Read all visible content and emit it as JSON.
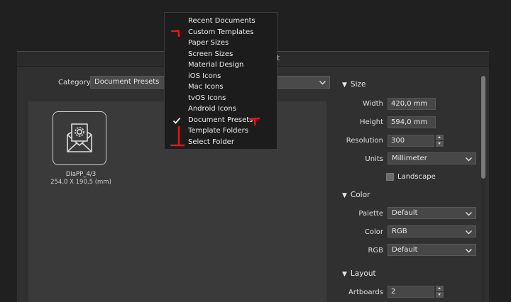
{
  "dialog": {
    "title_fragment": "t"
  },
  "category": {
    "label": "Category",
    "selected": "Document Presets"
  },
  "presets": [
    {
      "name": "DiaPP_4/3",
      "dims": "254,0 X 190,5 (mm)",
      "icon": "envelope-gear-icon"
    }
  ],
  "menu": {
    "items": [
      {
        "label": "Recent Documents",
        "checked": false
      },
      {
        "label": "Custom Templates",
        "checked": false
      },
      {
        "label": "Paper Sizes",
        "checked": false
      },
      {
        "label": "Screen Sizes",
        "checked": false
      },
      {
        "label": "Material Design",
        "checked": false
      },
      {
        "label": "iOS Icons",
        "checked": false
      },
      {
        "label": "Mac Icons",
        "checked": false
      },
      {
        "label": "tvOS Icons",
        "checked": false
      },
      {
        "label": "Android Icons",
        "checked": false
      },
      {
        "label": "Document Presets",
        "checked": true
      },
      {
        "label": "Template Folders",
        "checked": false
      },
      {
        "label": "Select Folder",
        "checked": false
      }
    ]
  },
  "size": {
    "heading": "Size",
    "width_label": "Width",
    "width_value": "420,0 mm",
    "height_label": "Height",
    "height_value": "594,0 mm",
    "resolution_label": "Resolution",
    "resolution_value": "300",
    "units_label": "Units",
    "units_value": "Millimeter",
    "landscape_label": "Landscape"
  },
  "color": {
    "heading": "Color",
    "palette_label": "Palette",
    "palette_value": "Default",
    "color_label": "Color",
    "color_value": "RGB",
    "rgb_label": "RGB",
    "rgb_value": "Default"
  },
  "layout": {
    "heading": "Layout",
    "artboards_label": "Artboards",
    "artboards_value": "2"
  },
  "colors": {
    "annotation": "#e8141c"
  }
}
